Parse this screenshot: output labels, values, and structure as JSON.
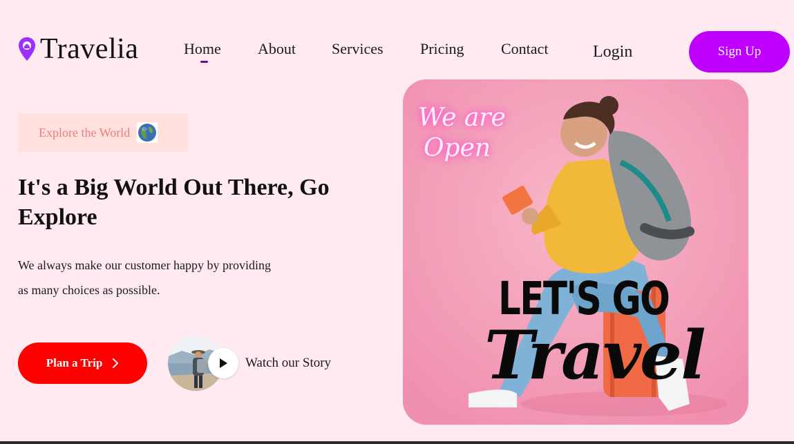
{
  "brand": {
    "name": "Travelia"
  },
  "nav": {
    "links": [
      "Home",
      "About",
      "Services",
      "Pricing",
      "Contact"
    ],
    "active": "Home",
    "login": "Login",
    "signup": "Sign Up"
  },
  "hero": {
    "badge": "Explore the World",
    "headline": "It's a Big World Out There, Go Explore",
    "subtext_line1": "We always make our customer happy by providing",
    "subtext_line2": "as many choices as possible.",
    "cta_primary": "Plan a Trip",
    "cta_secondary": "Watch our Story"
  },
  "hero_image": {
    "neon_line1": "We are",
    "neon_line2": "Open",
    "headline_1": "LET'S GO",
    "headline_2": "Travel"
  },
  "icons": {
    "logo": "location-pin-icon",
    "badge": "globe-icon",
    "cta_primary": "chevron-right-icon",
    "play": "play-icon"
  },
  "colors": {
    "background": "#ffeaf2",
    "accent": "#c000ff",
    "cta": "#ff0000",
    "badge_bg": "#ffe0dc",
    "badge_text": "#e8807f",
    "active_underline": "#6a0f7d"
  }
}
